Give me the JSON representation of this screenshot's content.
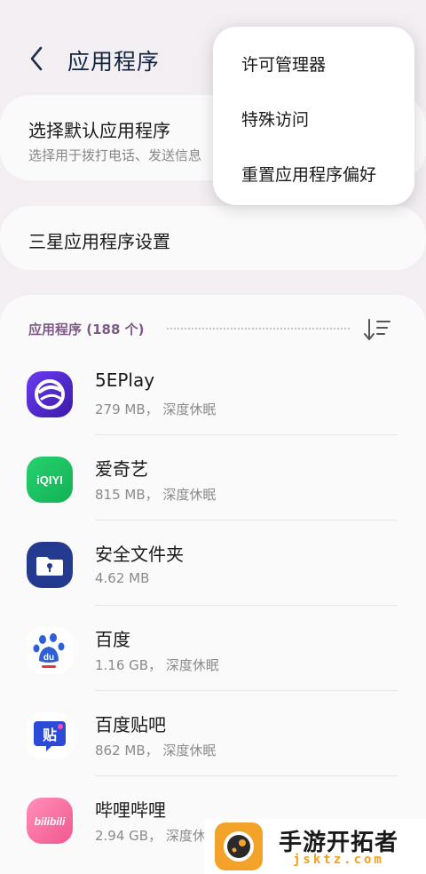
{
  "header": {
    "title": "应用程序"
  },
  "default_apps": {
    "title": "选择默认应用程序",
    "subtitle": "选择用于拨打电话、发送信息"
  },
  "samsung_settings": {
    "title": "三星应用程序设置"
  },
  "apps_section": {
    "header": "应用程序 (188 个)",
    "items": [
      {
        "name": "5EPlay",
        "meta": "279 MB， 深度休眠",
        "icon": "5eplay-icon"
      },
      {
        "name": "爱奇艺",
        "meta": "815 MB， 深度休眠",
        "icon": "iqiyi-icon"
      },
      {
        "name": "安全文件夹",
        "meta": "4.62 MB",
        "icon": "secure-folder-icon"
      },
      {
        "name": "百度",
        "meta": "1.16 GB， 深度休眠",
        "icon": "baidu-icon"
      },
      {
        "name": "百度贴吧",
        "meta": "862 MB， 深度休眠",
        "icon": "tieba-icon"
      },
      {
        "name": "哔哩哔哩",
        "meta": "2.94 GB， 深度休眠",
        "icon": "bilibili-icon"
      }
    ]
  },
  "menu": {
    "items": [
      {
        "label": "许可管理器"
      },
      {
        "label": "特殊访问"
      },
      {
        "label": "重置应用程序偏好"
      }
    ]
  },
  "watermark": {
    "title": "手游开拓者",
    "url": "jsktz.com"
  },
  "colors": {
    "background": "#f2eef2",
    "card": "#fbfafb",
    "section_header": "#7b5a86",
    "title": "#12243f"
  }
}
